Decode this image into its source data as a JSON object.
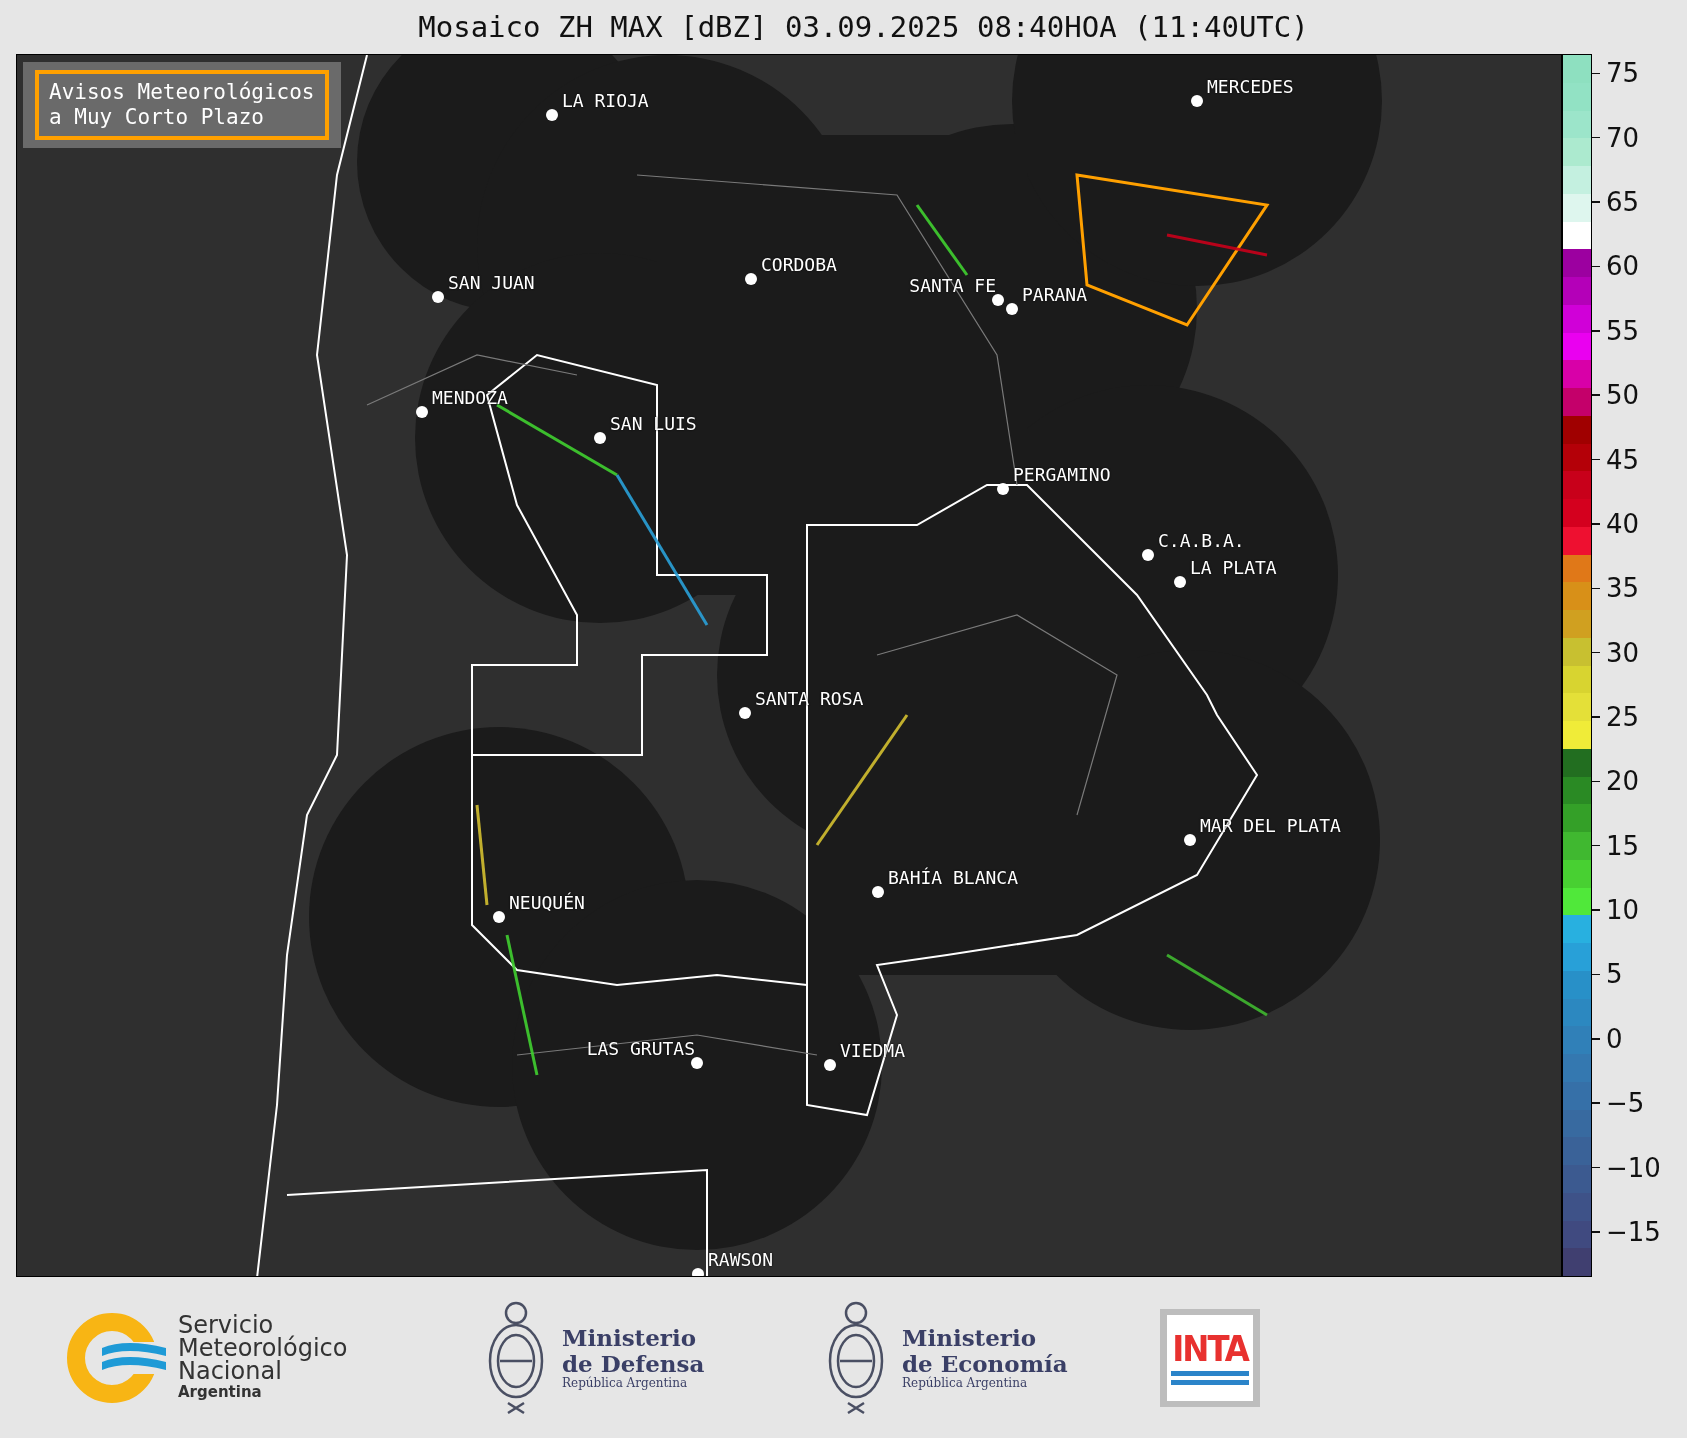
{
  "title": "Mosaico ZH MAX [dBZ] 03.09.2025 08:40HOA (11:40UTC)",
  "warning_box": {
    "text": "Avisos Meteorológicos\na Muy Corto Plazo"
  },
  "cities": [
    {
      "name": "LA RIOJA"
    },
    {
      "name": "SAN JUAN"
    },
    {
      "name": "CORDOBA"
    },
    {
      "name": "SANTA FE"
    },
    {
      "name": "PARANA"
    },
    {
      "name": "MERCEDES"
    },
    {
      "name": "MENDOZA"
    },
    {
      "name": "SAN LUIS"
    },
    {
      "name": "PERGAMINO"
    },
    {
      "name": "C.A.B.A."
    },
    {
      "name": "LA PLATA"
    },
    {
      "name": "SANTA ROSA"
    },
    {
      "name": "MAR DEL PLATA"
    },
    {
      "name": "BAHÍA BLANCA"
    },
    {
      "name": "NEUQUÉN"
    },
    {
      "name": "LAS GRUTAS"
    },
    {
      "name": "VIEDMA"
    },
    {
      "name": "RAWSON"
    }
  ],
  "colorbar": {
    "steps": [
      {
        "color": "#8ee0c0"
      },
      {
        "color": "#92e2c4"
      },
      {
        "color": "#9ce5ca"
      },
      {
        "color": "#aceacf"
      },
      {
        "color": "#c4f0e0"
      },
      {
        "color": "#def6ee"
      },
      {
        "color": "#ffffff"
      },
      {
        "color": "#9c00a0"
      },
      {
        "color": "#b400b8"
      },
      {
        "color": "#d000d8"
      },
      {
        "color": "#ea00f0"
      },
      {
        "color": "#d800a8"
      },
      {
        "color": "#c4006a"
      },
      {
        "color": "#a00000"
      },
      {
        "color": "#b40008"
      },
      {
        "color": "#c8001a"
      },
      {
        "color": "#d4001e"
      },
      {
        "color": "#ee1030"
      },
      {
        "color": "#e07818"
      },
      {
        "color": "#d89018"
      },
      {
        "color": "#d0a020"
      },
      {
        "color": "#c8c030"
      },
      {
        "color": "#d8d430"
      },
      {
        "color": "#e4e038"
      },
      {
        "color": "#f0ec38"
      },
      {
        "color": "#226e20"
      },
      {
        "color": "#2a8a24"
      },
      {
        "color": "#34a028"
      },
      {
        "color": "#40b830"
      },
      {
        "color": "#48d032"
      },
      {
        "color": "#50e83a"
      },
      {
        "color": "#28b0e0"
      },
      {
        "color": "#28a0d8"
      },
      {
        "color": "#2890c8"
      },
      {
        "color": "#2c88c0"
      },
      {
        "color": "#3080b8"
      },
      {
        "color": "#3478b0"
      },
      {
        "color": "#3670a8"
      },
      {
        "color": "#386aa0"
      },
      {
        "color": "#3a6298"
      },
      {
        "color": "#3c5a90"
      },
      {
        "color": "#3e5288"
      },
      {
        "color": "#404a80"
      },
      {
        "color": "#403f70"
      }
    ],
    "ticks": [
      "75",
      "70",
      "65",
      "60",
      "55",
      "50",
      "45",
      "40",
      "35",
      "30",
      "25",
      "20",
      "15",
      "10",
      "5",
      "0",
      "−5",
      "−10",
      "−15"
    ]
  },
  "logos": {
    "smn": {
      "name": "Servicio\nMeteorológico\nNacional",
      "subtitle": "Argentina"
    },
    "defensa": {
      "name": "Ministerio\nde Defensa",
      "subtitle": "República Argentina"
    },
    "economia": {
      "name": "Ministerio\nde Economía",
      "subtitle": "República Argentina"
    },
    "inta": {
      "name": "INTA"
    }
  }
}
